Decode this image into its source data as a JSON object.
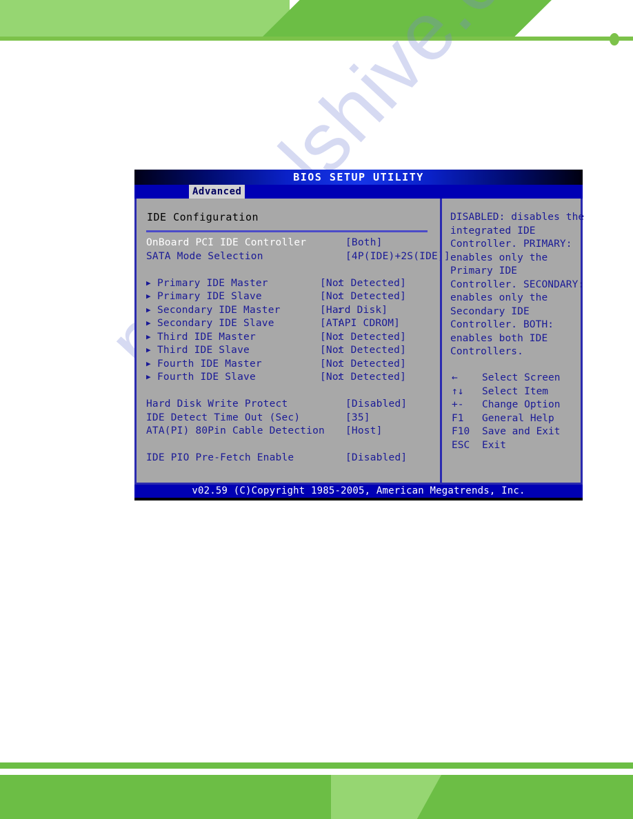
{
  "watermark": {
    "text": "manualshive.com"
  },
  "bios": {
    "title": "BIOS SETUP UTILITY",
    "tab": {
      "label": "Advanced"
    },
    "section_title": "IDE Configuration",
    "options": [
      {
        "kind": "plain",
        "label": "OnBoard PCI IDE Controller",
        "value": "[Both]",
        "selected": true,
        "column": "a"
      },
      {
        "kind": "plain",
        "label": "SATA Mode Selection",
        "value": "[4P(IDE)+2S(IDE)]",
        "selected": false,
        "column": "a"
      },
      {
        "kind": "spacer"
      },
      {
        "kind": "submenu",
        "label": "Primary IDE Master",
        "value": "[Not Detected]",
        "selected": false,
        "column": "b"
      },
      {
        "kind": "submenu",
        "label": "Primary IDE Slave",
        "value": "[Not Detected]",
        "selected": false,
        "column": "b"
      },
      {
        "kind": "submenu",
        "label": "Secondary IDE Master",
        "value": "[Hard Disk]",
        "selected": false,
        "column": "b"
      },
      {
        "kind": "submenu",
        "label": "Secondary IDE Slave",
        "value": "[ATAPI CDROM]",
        "selected": false,
        "column": "b"
      },
      {
        "kind": "submenu",
        "label": "Third IDE Master",
        "value": "[Not Detected]",
        "selected": false,
        "column": "b"
      },
      {
        "kind": "submenu",
        "label": "Third IDE Slave",
        "value": "[Not Detected]",
        "selected": false,
        "column": "b"
      },
      {
        "kind": "submenu",
        "label": "Fourth IDE Master",
        "value": "[Not Detected]",
        "selected": false,
        "column": "b"
      },
      {
        "kind": "submenu",
        "label": "Fourth IDE Slave",
        "value": "[Not Detected]",
        "selected": false,
        "column": "b"
      },
      {
        "kind": "spacer"
      },
      {
        "kind": "plain",
        "label": "Hard Disk Write Protect",
        "value": "[Disabled]",
        "selected": false,
        "column": "a"
      },
      {
        "kind": "plain",
        "label": "IDE Detect Time Out (Sec)",
        "value": "[35]",
        "selected": false,
        "column": "a"
      },
      {
        "kind": "plain",
        "label": "ATA(PI) 80Pin Cable Detection",
        "value": "[Host]",
        "selected": false,
        "column": "a"
      },
      {
        "kind": "spacer"
      },
      {
        "kind": "plain",
        "label": "IDE PIO Pre-Fetch Enable",
        "value": "[Disabled]",
        "selected": false,
        "column": "a"
      }
    ],
    "help_text": "DISABLED: disables the integrated IDE Controller. PRIMARY: enables only the Primary IDE Controller. SECONDARY: enables only the Secondary IDE Controller. BOTH: enables both IDE Controllers.",
    "keys": [
      {
        "key": "←",
        "desc": "Select Screen"
      },
      {
        "key": "↑↓",
        "desc": "Select Item"
      },
      {
        "key": "+-",
        "desc": "Change Option"
      },
      {
        "key": "F1",
        "desc": "General Help"
      },
      {
        "key": "F10",
        "desc": "Save and Exit"
      },
      {
        "key": "ESC",
        "desc": "Exit"
      }
    ],
    "footer": "v02.59 (C)Copyright 1985-2005, American Megatrends, Inc.",
    "colors": {
      "panel_bg": "#a8a8a8",
      "text_blue": "#1a1a96",
      "border_blue": "#2a2ab0",
      "bar_blue": "#0000b4",
      "selected_text": "#ffffff",
      "page_green_light": "#96d672",
      "page_green_dark": "#6cbe45"
    }
  }
}
